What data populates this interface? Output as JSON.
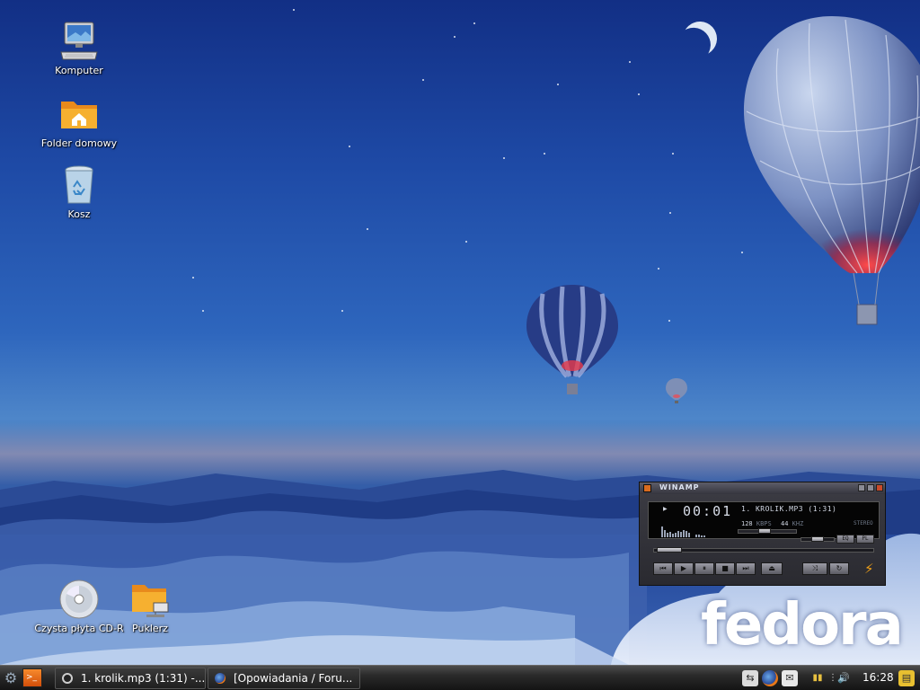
{
  "desktop": {
    "icons": [
      {
        "label": "Komputer"
      },
      {
        "label": "Folder domowy"
      },
      {
        "label": "Kosz"
      },
      {
        "label": "Czysta płyta CD-R"
      },
      {
        "label": "Puklerz"
      }
    ],
    "logo": "fedora"
  },
  "winamp": {
    "title": "WINAMP",
    "time": "00:01",
    "song": "1. KROLIK.MP3 (1:31)",
    "kbps": "128",
    "kbps_unit": "KBPS",
    "khz": "44",
    "khz_unit": "KHZ",
    "channel": "STEREO",
    "eq_label": "EQ",
    "pl_label": "PL",
    "position_fraction": 0.02,
    "volume_fraction": 0.45,
    "balance_fraction": 0.5
  },
  "taskbar": {
    "tasks": [
      {
        "label": "1. krolik.mp3 (1:31) -..."
      },
      {
        "label": "[Opowiadania / Foru..."
      }
    ],
    "clock": "16:28"
  },
  "colors": {
    "taskbar": "#1f1f1f",
    "sky_top": "#122f85",
    "winamp_body": "#2f2f36",
    "terminal_icon": "#e86a1a"
  }
}
